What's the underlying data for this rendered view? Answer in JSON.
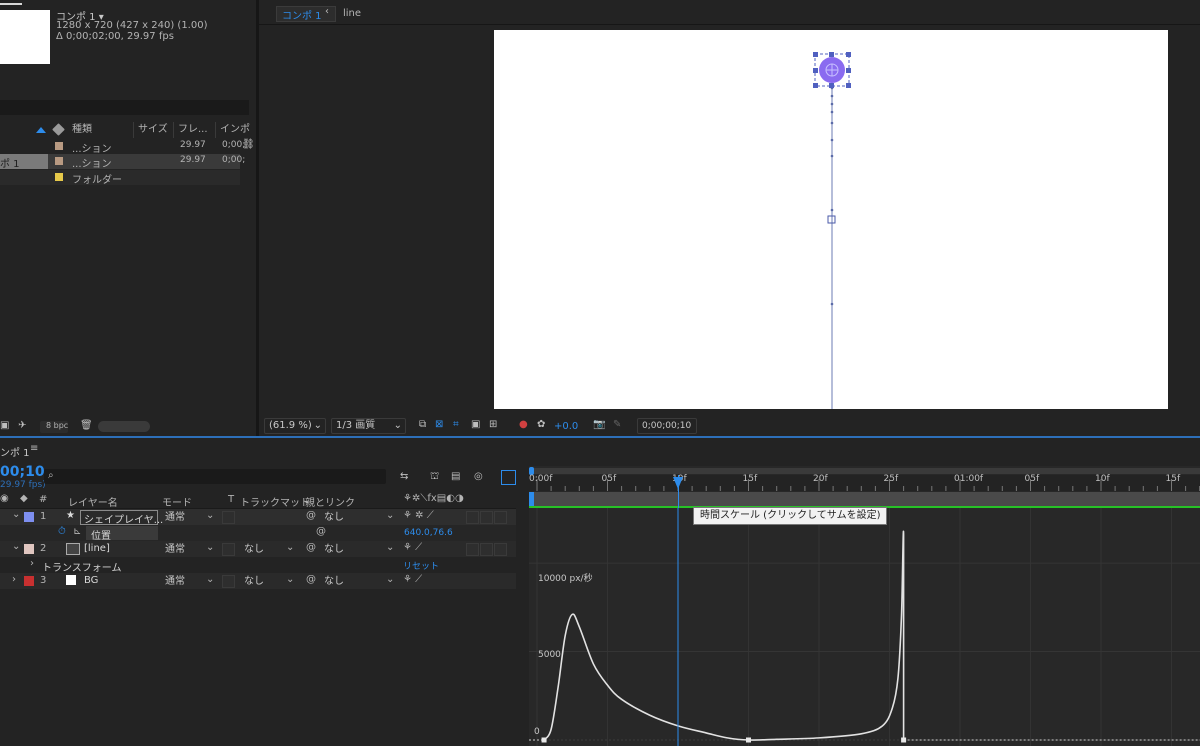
{
  "project": {
    "comp_name": "コンポ 1 ▾",
    "comp_size": "1280 x 720  (427 x 240) (1.00)",
    "comp_duration": "Δ 0;00;02;00, 29.97 fps",
    "columns": [
      "種類",
      "サイズ",
      "フレ...",
      "インポ"
    ],
    "items": [
      {
        "name": "",
        "type": "...ション",
        "fps": "29.97",
        "inpoint": "0;00;",
        "color": "#b89a82"
      },
      {
        "name": "ポ 1",
        "type": "...ション",
        "fps": "29.97",
        "inpoint": "0;00;",
        "color": "#b89a82"
      },
      {
        "name": "",
        "type": "フォルダー",
        "fps": "",
        "inpoint": "",
        "color": "#e6c94a"
      }
    ],
    "bpc": "8 bpc"
  },
  "viewer": {
    "tab_label": "コンポ 1",
    "breadcrumb": "line",
    "zoom": "(61.9 %)",
    "resolution": "1/3 画質",
    "exposure": "+0.0",
    "timecode": "0;00;00;10"
  },
  "timeline": {
    "tab_label": "ンポ 1",
    "current_time": "00;10",
    "fps": "29.97 fps)",
    "search_placeholder": "",
    "columns": {
      "layer_name": "レイヤー名",
      "mode": "モード",
      "t": "T",
      "track_matte": "トラックマット",
      "parent": "親とリンク"
    },
    "layers": [
      {
        "num": "1",
        "name": "シェイプレイヤ...",
        "mode": "通常",
        "matte": "",
        "parent": "なし",
        "label_color": "#7e8ff0",
        "icon": "star-icon"
      },
      {
        "num": "2",
        "name": "[line]",
        "mode": "通常",
        "matte": "なし",
        "parent": "なし",
        "label_color": "#e0c6c0",
        "icon": "comp-icon"
      },
      {
        "num": "3",
        "name": "BG",
        "mode": "通常",
        "matte": "なし",
        "parent": "なし",
        "label_color": "#c83030",
        "icon": "solid-icon"
      }
    ],
    "position_prop": {
      "name": "位置",
      "value": "640.0,76.6"
    },
    "transform_prop": {
      "name": "トランスフォーム",
      "reset": "リセット"
    },
    "ruler_ticks": [
      "0:00f",
      "05f",
      "10f",
      "15f",
      "20f",
      "25f",
      "01:00f",
      "05f",
      "10f",
      "15f"
    ],
    "tooltip": "時間スケール (クリックしてサムを設定)",
    "graph_label_top": "10000 px/秒",
    "graph_label_mid": "5000",
    "graph_label_zero": "0"
  },
  "chart_data": {
    "type": "line",
    "title": "",
    "ylabel": "px/秒",
    "yticks": [
      0,
      5000,
      10000
    ],
    "ylim": [
      0,
      13000
    ],
    "xlim": [
      0,
      48
    ],
    "series": [
      {
        "values": [
          [
            0.5,
            0
          ],
          [
            1,
            600
          ],
          [
            1.5,
            3000
          ],
          [
            2,
            5900
          ],
          [
            2.5,
            7100
          ],
          [
            3,
            6400
          ],
          [
            4,
            4300
          ],
          [
            5,
            3100
          ],
          [
            6,
            2300
          ],
          [
            8,
            1400
          ],
          [
            10,
            800
          ],
          [
            12,
            400
          ],
          [
            13.5,
            120
          ],
          [
            15,
            0
          ],
          [
            17,
            40
          ],
          [
            20,
            120
          ],
          [
            23,
            350
          ],
          [
            24.5,
            800
          ],
          [
            25.2,
            1800
          ],
          [
            25.6,
            3500
          ],
          [
            25.85,
            7000
          ],
          [
            26,
            11600
          ],
          [
            26,
            0
          ]
        ]
      }
    ],
    "keyframes_x": [
      0.5,
      15,
      26
    ]
  }
}
